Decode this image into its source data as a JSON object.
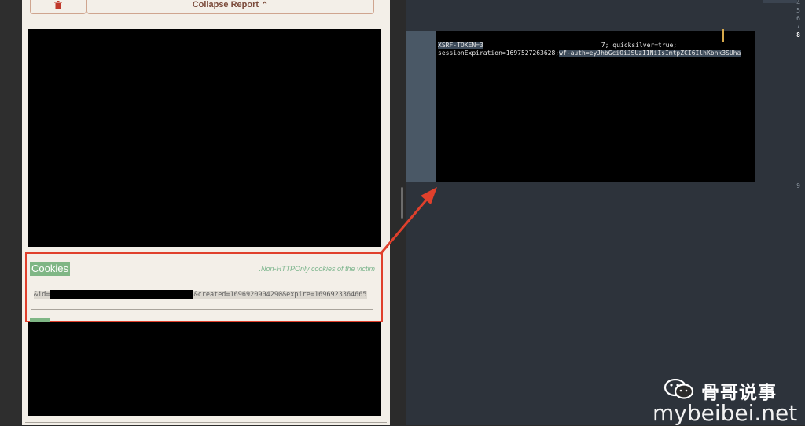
{
  "report": {
    "delete_icon": "trash-icon",
    "collapse_label": "Collapse Report",
    "collapse_icon": "double-chevron-up-icon",
    "cookies": {
      "heading": "Cookies",
      "note": ".Non-HTTPOnly cookies of the victim",
      "line_prefix": "&id=",
      "line_suffix": "&created=1696920904290&expire=1696923364665"
    }
  },
  "editor": {
    "line_numbers": [
      "4",
      "5",
      "6",
      "7",
      "8",
      "9"
    ],
    "active_line": "8",
    "code_line1_start": "XSRF-TOKEN=3",
    "code_line1_end": "7; quicksilver=true;",
    "code_line2_start": "sessionExpiration=1697527263628; ",
    "code_line2_sel": "wf-auth=eyJhbGciOiJSUzI1NiIsImtpZCI6IlhKbnk3SUha"
  },
  "watermark": {
    "name": "骨哥说事",
    "site": "mybeibei.net",
    "icon": "wechat-icon"
  },
  "colors": {
    "highlight_border": "#e0402c",
    "cookie_green": "#7fb685",
    "editor_bg": "#2d333b",
    "panel_bg": "#f3efe8"
  }
}
